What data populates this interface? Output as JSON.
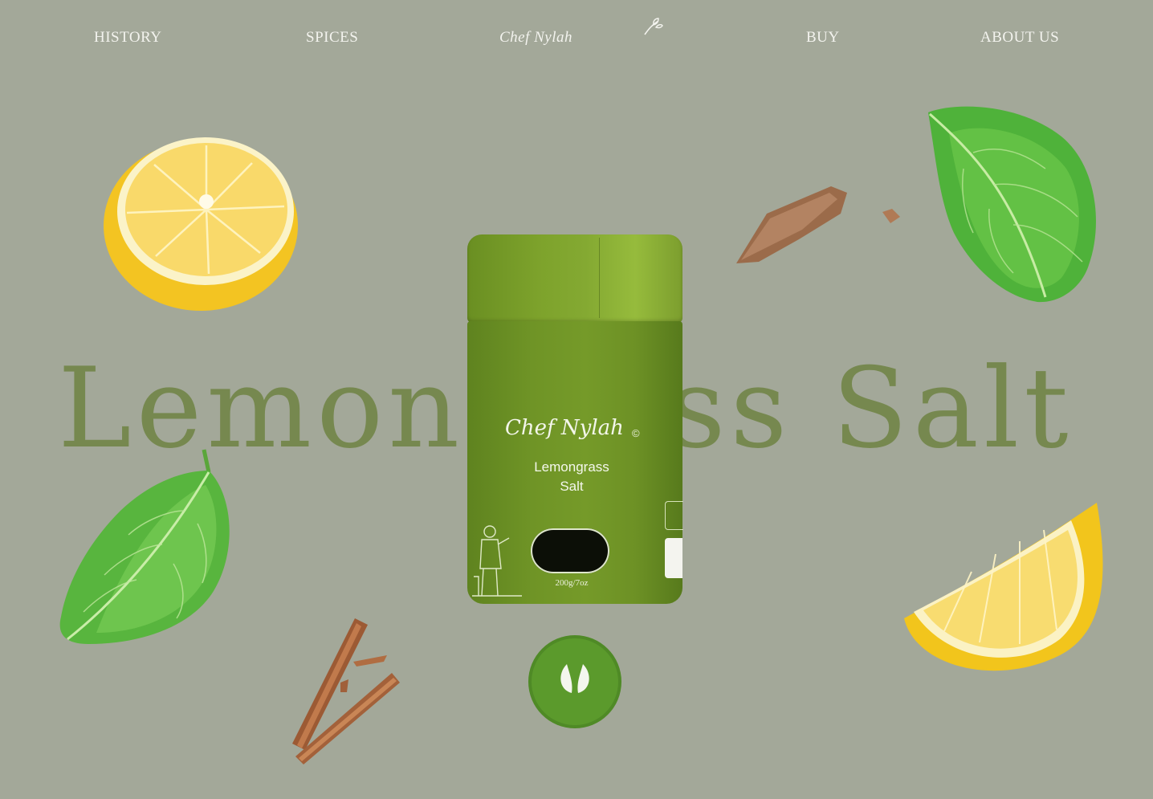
{
  "nav": {
    "items": [
      "HISTORY",
      "SPICES",
      "BUY",
      "ABOUT US"
    ],
    "logo": "Chef Nylah"
  },
  "hero": {
    "title": "Lemongrass Salt"
  },
  "product": {
    "brand": "Chef Nylah",
    "copyright": "©",
    "name_line1": "Lemongrass",
    "name_line2": "Salt",
    "weight": "200g/7oz"
  },
  "icons": {
    "logo_sprig": "leaf-sprig-icon",
    "badge": "leaf-badge-icon"
  },
  "colors": {
    "background": "#a3a899",
    "headline": "#76884f",
    "tin_green": "#759a29",
    "nav_text": "#f3f3ee"
  }
}
